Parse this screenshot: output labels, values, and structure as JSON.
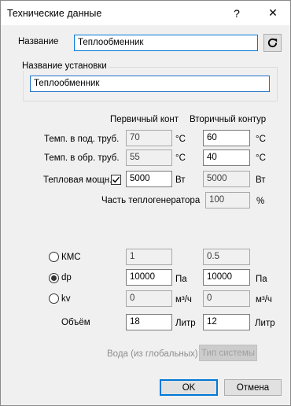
{
  "window": {
    "title": "Технические данные",
    "help": "?",
    "close": "✕"
  },
  "name": {
    "label": "Название",
    "value": "Теплообменник"
  },
  "installation": {
    "group_title": "Название установки",
    "value": "Теплообменник"
  },
  "columns": {
    "primary": "Первичный конт",
    "secondary": "Вторичный контур"
  },
  "rows": {
    "supply_temp": {
      "label": "Темп. в под. труб.",
      "primary": "70",
      "secondary": "60",
      "unit": "°C"
    },
    "return_temp": {
      "label": "Темп. в обр. труб.",
      "primary": "55",
      "secondary": "40",
      "unit": "°C"
    },
    "heat_power": {
      "label": "Тепловая мощн.",
      "checked": true,
      "primary": "5000",
      "secondary": "5000",
      "unit": "Вт"
    },
    "generator_share": {
      "label": "Часть теплогенератора",
      "value": "100",
      "unit": "%"
    }
  },
  "hydraulics": {
    "kms": {
      "label": "КМС",
      "primary": "1",
      "secondary": "0.5",
      "selected": false
    },
    "dp": {
      "label": "dp",
      "primary": "10000",
      "secondary": "10000",
      "unit": "Па",
      "selected": true
    },
    "kv": {
      "label": "kv",
      "primary": "0",
      "secondary": "0",
      "unit": "м³/ч",
      "selected": false
    },
    "volume": {
      "label": "Объём",
      "primary": "18",
      "secondary": "12",
      "unit": "Литр"
    }
  },
  "fluid": {
    "label": "Вода (из глобальных)",
    "button": "Тип системы"
  },
  "buttons": {
    "ok": "OK",
    "cancel": "Отмена"
  }
}
